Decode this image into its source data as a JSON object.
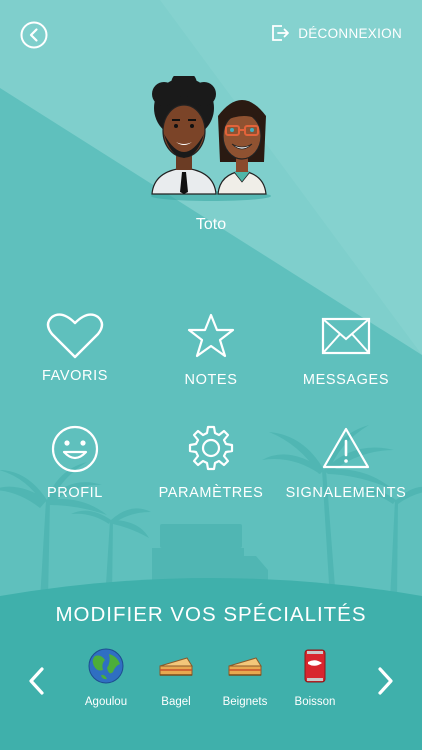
{
  "header": {
    "logout_label": "DÉCONNEXION"
  },
  "profile": {
    "username": "Toto"
  },
  "menu": {
    "favoris": "FAVORIS",
    "notes": "NOTES",
    "messages": "MESSAGES",
    "profil": "PROFIL",
    "parametres": "PARAMÈTRES",
    "signalements": "SIGNALEMENTS"
  },
  "specialites": {
    "title": "MODIFIER VOS SPÉCIALITÉS",
    "items": [
      {
        "label": "Agoulou",
        "icon": "globe-icon"
      },
      {
        "label": "Bagel",
        "icon": "cake-slice-icon"
      },
      {
        "label": "Beignets",
        "icon": "cake-slice-icon"
      },
      {
        "label": "Boisson",
        "icon": "soda-can-icon"
      }
    ]
  },
  "colors": {
    "background": "#5fc0bd",
    "bottom_band": "#3fb0ab",
    "silhouette": "#4fb6b2"
  }
}
